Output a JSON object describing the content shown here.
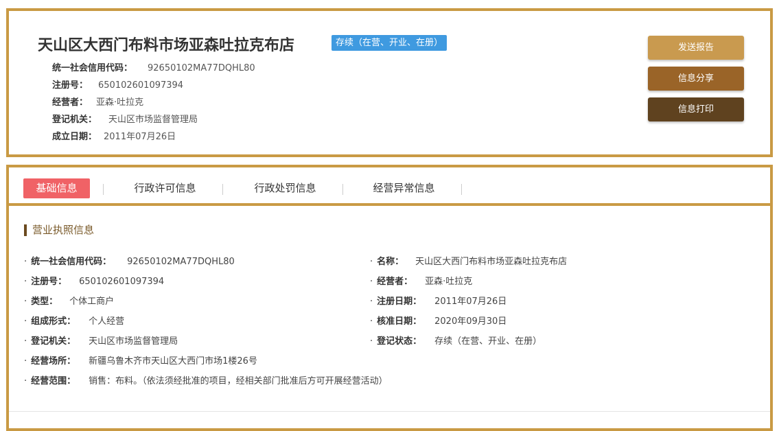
{
  "header": {
    "company_name": "天山区大西门布料市场亚森吐拉克布店",
    "status": "存续（在营、开业、在册）",
    "info": [
      {
        "label": "统一社会信用代码：",
        "value": "92650102MA77DQHL80"
      },
      {
        "label": "注册号：",
        "value": "650102601097394"
      },
      {
        "label": "经营者：",
        "value": "亚森·吐拉克"
      },
      {
        "label": "登记机关：",
        "value": "天山区市场监督管理局"
      },
      {
        "label": "成立日期：",
        "value": "2011年07月26日"
      }
    ],
    "buttons": {
      "send": "发送报告",
      "share": "信息分享",
      "print": "信息打印"
    }
  },
  "tabs": [
    "基础信息",
    "行政许可信息",
    "行政处罚信息",
    "经营异常信息"
  ],
  "section_title": "营业执照信息",
  "fields_left": [
    {
      "label": "统一社会信用代码：",
      "value": "92650102MA77DQHL80"
    },
    {
      "label": "注册号：",
      "value": "650102601097394"
    },
    {
      "label": "类型：",
      "value": "个体工商户"
    },
    {
      "label": "组成形式：",
      "value": "个人经营"
    },
    {
      "label": "登记机关：",
      "value": "天山区市场监督管理局"
    },
    {
      "label": "经营场所：",
      "value": "新疆乌鲁木齐市天山区大西门市场1楼26号"
    },
    {
      "label": "经营范围：",
      "value": "销售：布料。（依法须经批准的项目，经相关部门批准后方可开展经营活动）"
    }
  ],
  "fields_right": [
    {
      "label": "名称：",
      "value": "天山区大西门布料市场亚森吐拉克布店"
    },
    {
      "label": "经营者：",
      "value": "亚森·吐拉克"
    },
    {
      "label": "注册日期：",
      "value": "2011年07月26日"
    },
    {
      "label": "核准日期：",
      "value": "2020年09月30日"
    },
    {
      "label": "登记状态：",
      "value": "存续（在营、开业、在册）"
    }
  ],
  "colors": {
    "border": "#c99a44",
    "badge": "#3f9ae0",
    "active_tab": "#f06266",
    "btn_send": "#c99a4f",
    "btn_share": "#9a6428",
    "btn_print": "#5f421f"
  }
}
